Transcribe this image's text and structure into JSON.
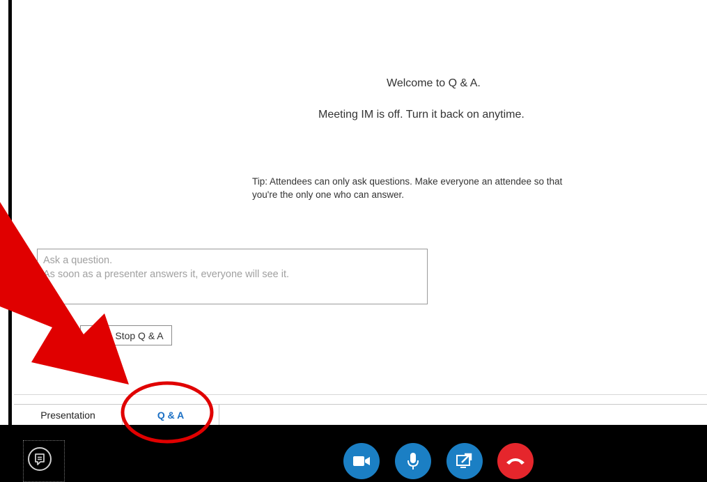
{
  "qa": {
    "welcome": "Welcome to Q & A.",
    "im_off": "Meeting IM is off. Turn it back on anytime.",
    "tip_line1": "Tip: Attendees can only ask questions. Make everyone an attendee so that",
    "tip_line2": "you're the only one who can answer.",
    "question_placeholder_line1": "Ask a question.",
    "question_placeholder_line2": "As soon as a presenter answers it, everyone will see it.",
    "stop_button": "Stop Q & A"
  },
  "tabs": {
    "presentation": "Presentation",
    "qa": "Q & A"
  },
  "controls": {
    "video": "video-camera-icon",
    "mic": "microphone-icon",
    "share": "share-screen-icon",
    "hangup": "hang-up-icon",
    "chat": "chat-icon"
  },
  "colors": {
    "accent_blue": "#1b7fc4",
    "hangup_red": "#e5262c",
    "tab_active_text": "#1a6fc4",
    "annotation_red": "#e00000"
  }
}
